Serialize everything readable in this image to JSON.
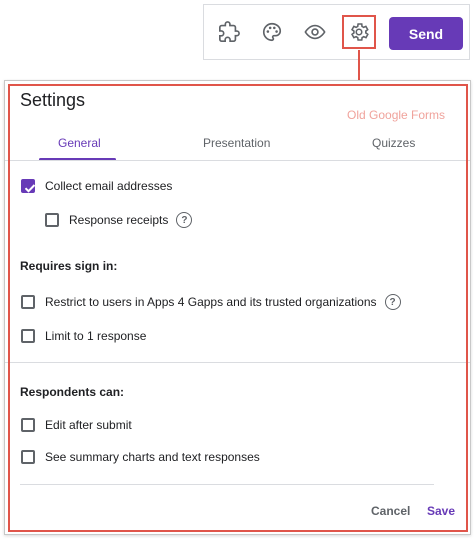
{
  "toolbar": {
    "icons": [
      "addon-puzzle-icon",
      "palette-icon",
      "eye-icon",
      "gear-icon"
    ],
    "send_label": "Send",
    "accent": "#673ab7"
  },
  "annotation": {
    "note": "Old Google Forms",
    "color": "#e0554a"
  },
  "dialog": {
    "title": "Settings",
    "tabs": [
      {
        "label": "General",
        "active": true
      },
      {
        "label": "Presentation",
        "active": false
      },
      {
        "label": "Quizzes",
        "active": false
      }
    ],
    "general": {
      "collect_email": {
        "label": "Collect email addresses",
        "checked": true
      },
      "response_receipts": {
        "label": "Response receipts",
        "checked": false
      },
      "requires_sign_in": {
        "heading": "Requires sign in:",
        "restrict": {
          "label": "Restrict to users in Apps 4 Gapps and its trusted organizations",
          "checked": false
        },
        "limit": {
          "label": "Limit to 1 response",
          "checked": false
        }
      },
      "respondents_can": {
        "heading": "Respondents can:",
        "edit": {
          "label": "Edit after submit",
          "checked": false
        },
        "summary": {
          "label": "See summary charts and text responses",
          "checked": false
        }
      }
    },
    "cancel_label": "Cancel",
    "save_label": "Save"
  }
}
